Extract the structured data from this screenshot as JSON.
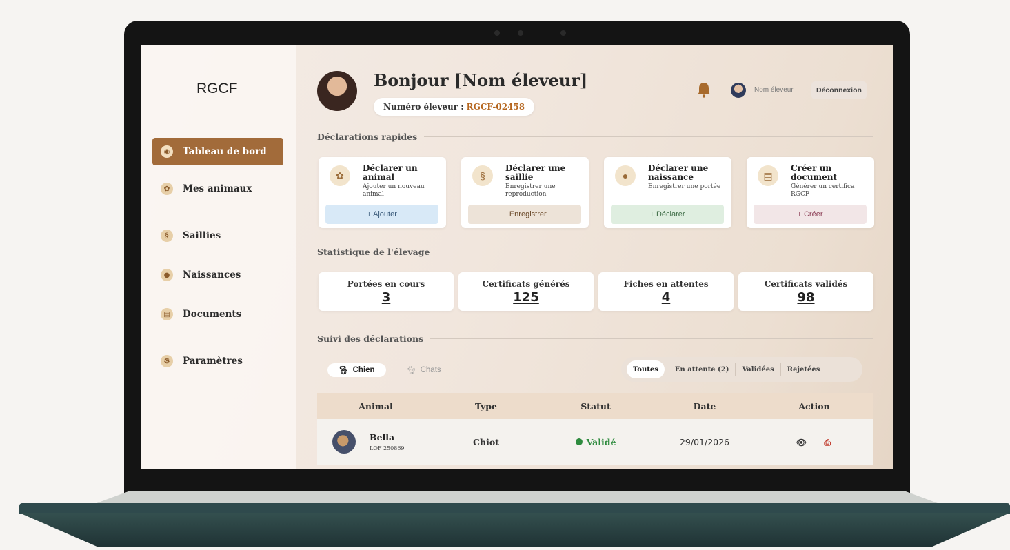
{
  "sidebar": {
    "brand": "RGCF",
    "items": [
      {
        "label": "Tableau de bord",
        "icon": "dashboard-icon",
        "active": true
      },
      {
        "label": "Mes animaux",
        "icon": "paw-icon"
      },
      {
        "label": "Saillies",
        "icon": "mating-icon"
      },
      {
        "label": "Naissances",
        "icon": "birth-icon"
      },
      {
        "label": "Documents",
        "icon": "document-icon"
      },
      {
        "label": "Paramètres",
        "icon": "settings-icon"
      }
    ]
  },
  "header": {
    "greeting": "Bonjour [Nom éleveur]",
    "breeder_label": "Numéro éleveur :",
    "breeder_number": "RGCF-02458",
    "user_name": "Nom éleveur",
    "logout": "Déconnexion"
  },
  "quick": {
    "title": "Déclarations rapides",
    "cards": [
      {
        "title": "Déclarer un animal",
        "desc": "Ajouter un nouveau animal",
        "button": "+ Ajouter",
        "color": "#d8e9f7",
        "text_color": "#3a5a7a"
      },
      {
        "title": "Déclarer une saillie",
        "desc": "Enregistrer une reproduction",
        "button": "+ Enregistrer",
        "color": "#ede3d8",
        "text_color": "#6b4a2a"
      },
      {
        "title": "Déclarer une naissance",
        "desc": "Enregistrer une portée",
        "button": "+ Déclarer",
        "color": "#dfeee0",
        "text_color": "#3d6b45"
      },
      {
        "title": "Créer un document",
        "desc": "Générer un certifica RGCF",
        "button": "+ Créer",
        "color": "#f2e6e7",
        "text_color": "#8a3a52"
      }
    ]
  },
  "stats": {
    "title": "Statistique de l'élevage",
    "items": [
      {
        "label": "Portées en cours",
        "value": "3"
      },
      {
        "label": "Certificats générés",
        "value": "125"
      },
      {
        "label": "Fiches en attentes",
        "value": "4"
      },
      {
        "label": "Certificats validés",
        "value": "98"
      }
    ]
  },
  "tracking": {
    "title": "Suivi des déclarations",
    "pet_tabs": [
      "Chien",
      "Chats"
    ],
    "filters": [
      "Toutes",
      "En attente (2)",
      "Validées",
      "Rejetées"
    ],
    "columns": [
      "Animal",
      "Type",
      "Statut",
      "Date",
      "Action"
    ],
    "rows": [
      {
        "name": "Bella",
        "lof": "LOF 250869",
        "type": "Chiot",
        "status": "Validé",
        "date": "29/01/2026"
      }
    ]
  },
  "colors": {
    "accent": "#a26b3a",
    "breeder_number": "#b5651d",
    "status_valid": "#2e8b3e"
  }
}
